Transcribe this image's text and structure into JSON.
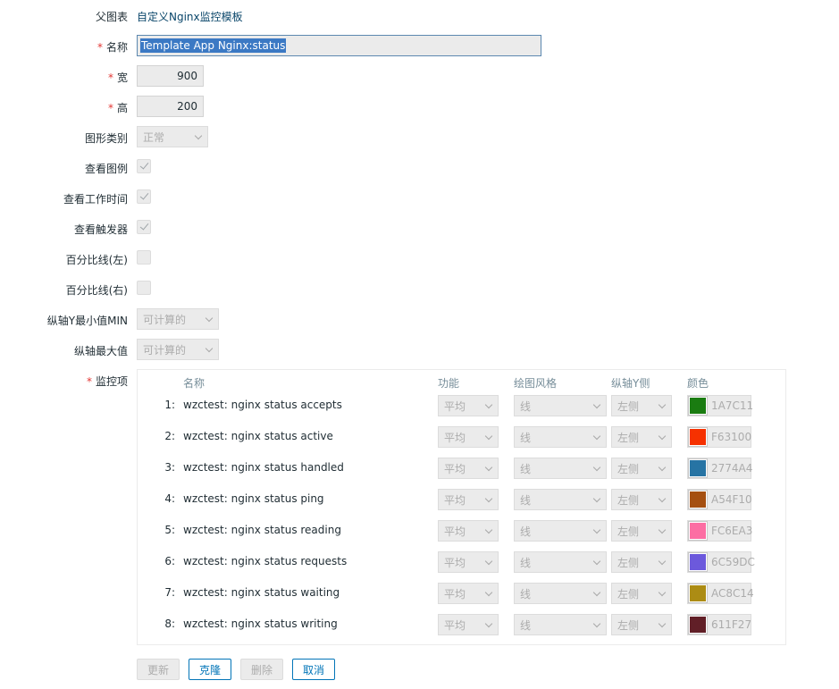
{
  "form": {
    "parent": {
      "label": "父图表",
      "value": "自定义Nginx监控模板"
    },
    "name": {
      "label": "名称",
      "required_mark": "*",
      "value": "Template App Nginx:status"
    },
    "width": {
      "label": "宽",
      "required_mark": "*",
      "value": "900"
    },
    "height": {
      "label": "高",
      "required_mark": "*",
      "value": "200"
    },
    "graph_type": {
      "label": "图形类别",
      "value": "正常"
    },
    "show_legend": {
      "label": "查看图例",
      "checked": true
    },
    "show_work_period": {
      "label": "查看工作时间",
      "checked": true
    },
    "show_triggers": {
      "label": "查看触发器",
      "checked": true
    },
    "percentile_left": {
      "label": "百分比线(左)",
      "checked": false
    },
    "percentile_right": {
      "label": "百分比线(右)",
      "checked": false
    },
    "y_min": {
      "label": "纵轴Y最小值MIN",
      "value": "可计算的"
    },
    "y_max": {
      "label": "纵轴最大值",
      "value": "可计算的"
    },
    "items": {
      "label": "监控项",
      "required_mark": "*"
    }
  },
  "items_table": {
    "headers": {
      "name": "名称",
      "function": "功能",
      "draw_style": "绘图风格",
      "y_side": "纵轴Y侧",
      "color": "颜色"
    },
    "rows": [
      {
        "num": "1:",
        "name": "wzctest: nginx status accepts",
        "function": "平均",
        "draw_style": "线",
        "y_side": "左侧",
        "color": "1A7C11",
        "swatch": "#1A7C11"
      },
      {
        "num": "2:",
        "name": "wzctest: nginx status active",
        "function": "平均",
        "draw_style": "线",
        "y_side": "左侧",
        "color": "F63100",
        "swatch": "#F63100"
      },
      {
        "num": "3:",
        "name": "wzctest: nginx status handled",
        "function": "平均",
        "draw_style": "线",
        "y_side": "左侧",
        "color": "2774A4",
        "swatch": "#2774A4"
      },
      {
        "num": "4:",
        "name": "wzctest: nginx status ping",
        "function": "平均",
        "draw_style": "线",
        "y_side": "左侧",
        "color": "A54F10",
        "swatch": "#A54F10"
      },
      {
        "num": "5:",
        "name": "wzctest: nginx status reading",
        "function": "平均",
        "draw_style": "线",
        "y_side": "左侧",
        "color": "FC6EA3",
        "swatch": "#FC6EA3"
      },
      {
        "num": "6:",
        "name": "wzctest: nginx status requests",
        "function": "平均",
        "draw_style": "线",
        "y_side": "左侧",
        "color": "6C59DC",
        "swatch": "#6C59DC"
      },
      {
        "num": "7:",
        "name": "wzctest: nginx status waiting",
        "function": "平均",
        "draw_style": "线",
        "y_side": "左侧",
        "color": "AC8C14",
        "swatch": "#AC8C14"
      },
      {
        "num": "8:",
        "name": "wzctest: nginx status writing",
        "function": "平均",
        "draw_style": "线",
        "y_side": "左侧",
        "color": "611F27",
        "swatch": "#611F27"
      }
    ]
  },
  "buttons": {
    "update": "更新",
    "clone": "克隆",
    "delete": "删除",
    "cancel": "取消"
  }
}
